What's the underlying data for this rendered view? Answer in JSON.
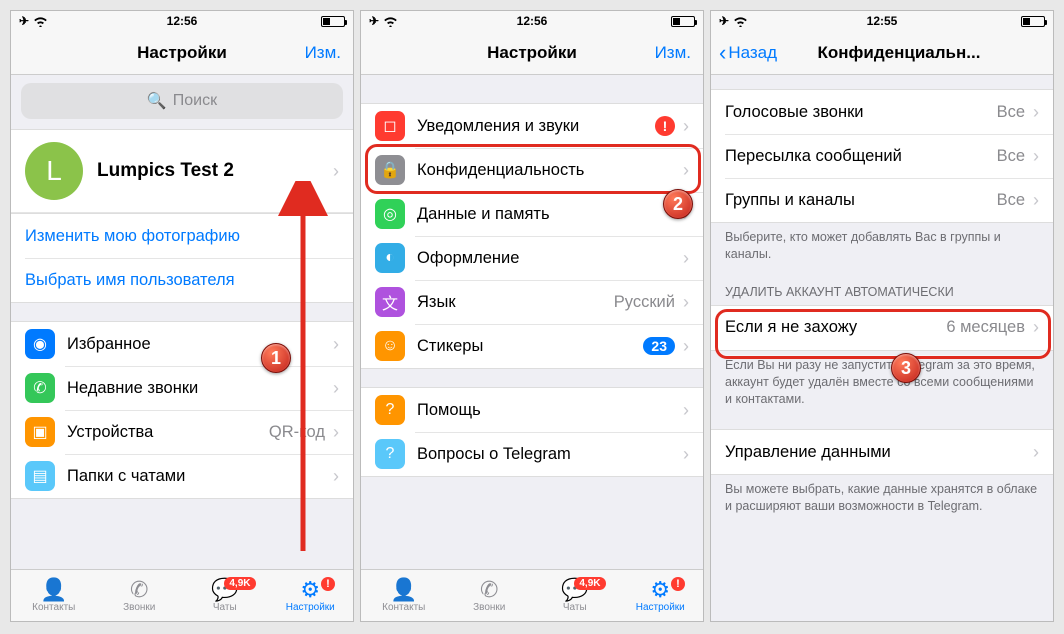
{
  "status": {
    "time1": "12:56",
    "time2": "12:56",
    "time3": "12:55"
  },
  "nav": {
    "settings_title": "Настройки",
    "edit": "Изм.",
    "back": "Назад",
    "privacy_title": "Конфиденциальн..."
  },
  "search": {
    "placeholder": "Поиск"
  },
  "profile": {
    "avatar_initial": "L",
    "name": "Lumpics Test 2",
    "change_photo": "Изменить мою фотографию",
    "set_username": "Выбрать имя пользователя"
  },
  "s1_items": {
    "saved": "Избранное",
    "recent_calls": "Недавние звонки",
    "devices": "Устройства",
    "devices_value": "QR-код",
    "folders": "Папки с чатами"
  },
  "s2_items": {
    "notifications": "Уведомления и звуки",
    "privacy": "Конфиденциальность",
    "data": "Данные и память",
    "appearance": "Оформление",
    "language": "Язык",
    "language_value": "Русский",
    "stickers": "Стикеры",
    "stickers_count": "23",
    "help": "Помощь",
    "faq": "Вопросы о Telegram"
  },
  "s3": {
    "voice_calls": "Голосовые звонки",
    "forwarding": "Пересылка сообщений",
    "groups": "Группы и каналы",
    "value_all": "Все",
    "groups_footer": "Выберите, кто может добавлять Вас в группы и каналы.",
    "delete_header": "УДАЛИТЬ АККАУНТ АВТОМАТИЧЕСКИ",
    "if_away": "Если я не захожу",
    "if_away_value": "6 месяцев",
    "if_away_footer": "Если Вы ни разу не запустите Telegram за это время, аккаунт будет удалён вместе со всеми сообщениями и контактами.",
    "data_mgmt": "Управление данными",
    "data_mgmt_footer": "Вы можете выбрать, какие данные хранятся в облаке и расширяют ваши возможности в Telegram."
  },
  "tabs": {
    "contacts": "Контакты",
    "calls": "Звонки",
    "chats": "Чаты",
    "settings": "Настройки",
    "chats_badge": "4,9K",
    "settings_alert": "!"
  },
  "steps": {
    "s1": "1",
    "s2": "2",
    "s3": "3"
  }
}
